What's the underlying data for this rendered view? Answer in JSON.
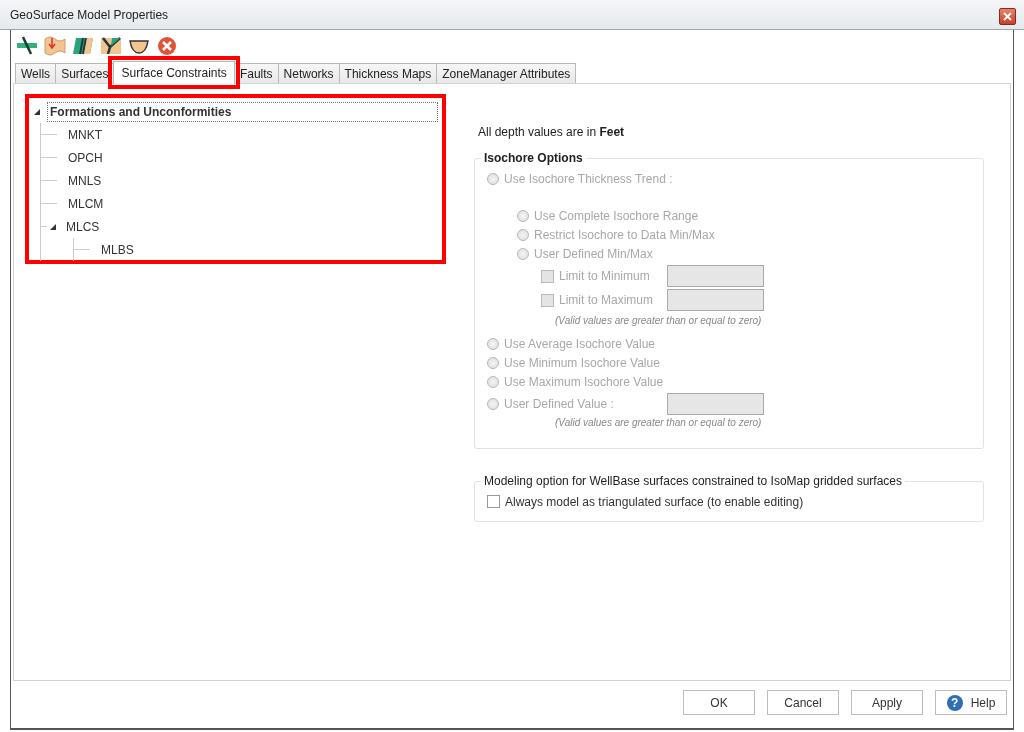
{
  "window": {
    "title": "GeoSurface Model Properties"
  },
  "toolbar": [
    {
      "kind": "cross-line"
    },
    {
      "kind": "map"
    },
    {
      "kind": "fault-block"
    },
    {
      "kind": "v-block"
    },
    {
      "kind": "bowl"
    },
    {
      "kind": "cancel"
    }
  ],
  "tabs": [
    {
      "label": "Wells",
      "selected": false,
      "highlighted": false
    },
    {
      "label": "Surfaces",
      "selected": false,
      "highlighted": false
    },
    {
      "label": "Surface Constraints",
      "selected": true,
      "highlighted": true
    },
    {
      "label": "Faults",
      "selected": false,
      "highlighted": false
    },
    {
      "label": "Networks",
      "selected": false,
      "highlighted": false
    },
    {
      "label": "Thickness Maps",
      "selected": false,
      "highlighted": false
    },
    {
      "label": "ZoneManager Attributes",
      "selected": false,
      "highlighted": false
    }
  ],
  "tree": {
    "highlighted": true,
    "items": [
      {
        "label": "Formations and Unconformities",
        "selected": true,
        "expanded": true,
        "children": [
          {
            "label": "MNKT",
            "selected": false
          },
          {
            "label": "OPCH",
            "selected": false
          },
          {
            "label": "MNLS",
            "selected": false
          },
          {
            "label": "MLCM",
            "selected": false
          },
          {
            "label": "MLCS",
            "selected": false,
            "expanded": true,
            "children": [
              {
                "label": "MLBS",
                "selected": false
              }
            ]
          }
        ]
      }
    ]
  },
  "units_note": "All depth values are in **Feet**",
  "isochore_options": {
    "title": "Isochore Options",
    "disabled": true,
    "items": [
      {
        "kind": "radio",
        "label": "Use Isochore Thickness Trend :",
        "selected": false,
        "children": [
          {
            "kind": "radio",
            "label": "Use Complete Isochore Range",
            "selected": false
          },
          {
            "kind": "radio",
            "label": "Restrict Isochore to Data Min/Max",
            "selected": false
          },
          {
            "kind": "radio",
            "label": "User Defined Min/Max",
            "selected": false,
            "children": [
              {
                "kind": "checkbox-field",
                "label": "Limit to Minimum",
                "checked": false
              },
              {
                "kind": "checkbox-field",
                "label": "Limit to Maximum",
                "checked": false
              },
              {
                "kind": "note",
                "text": "(Valid values are greater than or equal to zero)"
              }
            ]
          }
        ]
      },
      {
        "kind": "radio",
        "label": "Use Average Isochore Value",
        "selected": false
      },
      {
        "kind": "radio",
        "label": "Use Minimum Isochore Value",
        "selected": false
      },
      {
        "kind": "radio",
        "label": "Use Maximum Isochore Value",
        "selected": false
      },
      {
        "kind": "radio-field",
        "label": "User Defined Value :",
        "selected": false
      },
      {
        "kind": "note",
        "text": "(Valid values are greater than or equal to zero)"
      }
    ]
  },
  "modeling_option": {
    "title": "Modeling option for WellBase surfaces constrained to IsoMap gridded surfaces",
    "items": [
      {
        "kind": "checkbox",
        "label": "Always model as triangulated surface (to enable editing)",
        "checked": false
      }
    ]
  },
  "buttons": [
    {
      "kind": "plain",
      "label": "OK"
    },
    {
      "kind": "plain",
      "label": "Cancel"
    },
    {
      "kind": "plain",
      "label": "Apply"
    },
    {
      "kind": "help",
      "label": "Help",
      "icon": "?"
    }
  ]
}
